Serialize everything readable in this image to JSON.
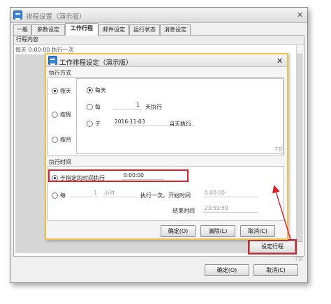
{
  "outer_window": {
    "title": "排程设置（演示版）",
    "tabs": [
      "一般",
      "参数设定",
      "工作行程",
      "邮件设定",
      "运行状态",
      "消息设定"
    ],
    "active_tab_index": 2,
    "group_header": "行程内容",
    "task_text": "每天 0:00:00 执行一次",
    "set_schedule_button": "设定行程",
    "ok_button": "确定(O)",
    "cancel_button": "取消(C)",
    "logo": "TB"
  },
  "inner_dialog": {
    "title": "工作排程设定（演示版）",
    "exec_mode": {
      "label": "执行方式",
      "by_day": "按天",
      "by_week": "按周",
      "by_month": "按月",
      "every_day": "每天",
      "every": "每",
      "every_n_value": "1",
      "days_execute": "天执行",
      "on": "于",
      "date_value": "2016-11-03",
      "on_day_execute": "当天执行",
      "logo": "TB"
    },
    "exec_time": {
      "label": "执行时间",
      "at_time": "于指定的时间执行",
      "time_value": "0:00:00",
      "every": "每",
      "interval_value": "1",
      "interval_unit": "小时",
      "once_start_at": "执行一次，开始时间",
      "start_value": "0:00:00",
      "end_label": "结束时间",
      "end_value": "23:59:59"
    },
    "ok_button": "确定(O)",
    "clear_button": "清除(L)",
    "cancel_button": "取消(C)"
  },
  "colors": {
    "highlight_red": "#e0202a",
    "dialog_border": "#f0c04a",
    "app_icon": "#3b83d6"
  }
}
